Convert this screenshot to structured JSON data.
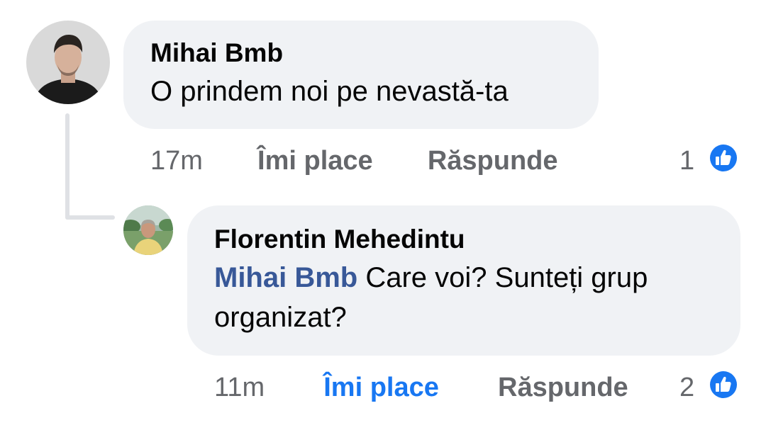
{
  "comments": [
    {
      "author": "Mihai Bmb",
      "text": "O prindem noi pe nevastă-ta",
      "time": "17m",
      "like_label": "Îmi place",
      "reply_label": "Răspunde",
      "reaction_count": "1",
      "liked": false,
      "reaction_icon": "like-icon"
    },
    {
      "author": "Florentin Mehedintu",
      "mention": "Mihai Bmb",
      "text_line1": " Care voi? Sunteți grup",
      "text_line2": "organizat?",
      "time": "11m",
      "like_label": "Îmi place",
      "reply_label": "Răspunde",
      "reaction_count": "2",
      "liked": true,
      "reaction_icon": "like-icon"
    }
  ],
  "colors": {
    "bubble": "#f0f2f5",
    "meta_text": "#65676b",
    "liked": "#1877f2",
    "mention": "#385898",
    "thread_line": "#dfe1e5"
  }
}
